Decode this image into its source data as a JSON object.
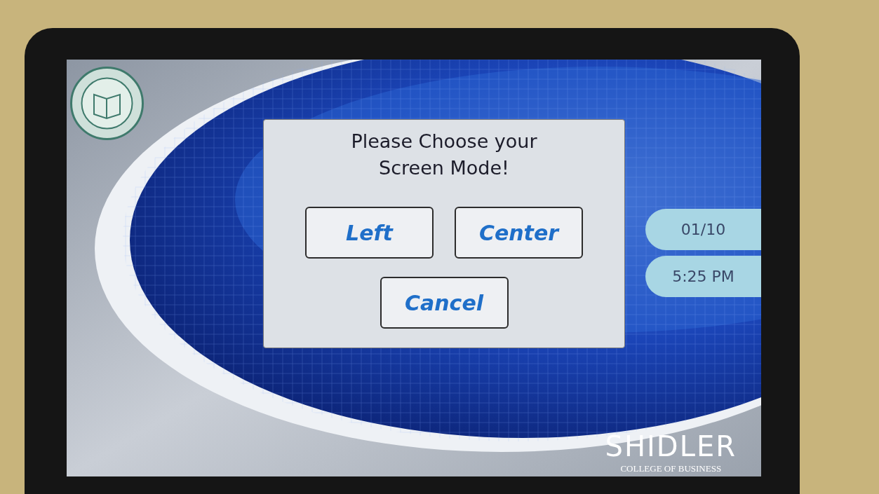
{
  "dialog": {
    "title": "Please Choose your Screen Mode!",
    "buttons": [
      "Left",
      "Center",
      "Cancel"
    ]
  },
  "date": "01/10",
  "time": "5:25 PM",
  "brand": {
    "name": "SHIDLER",
    "subtitle": "COLLEGE OF BUSINESS"
  }
}
